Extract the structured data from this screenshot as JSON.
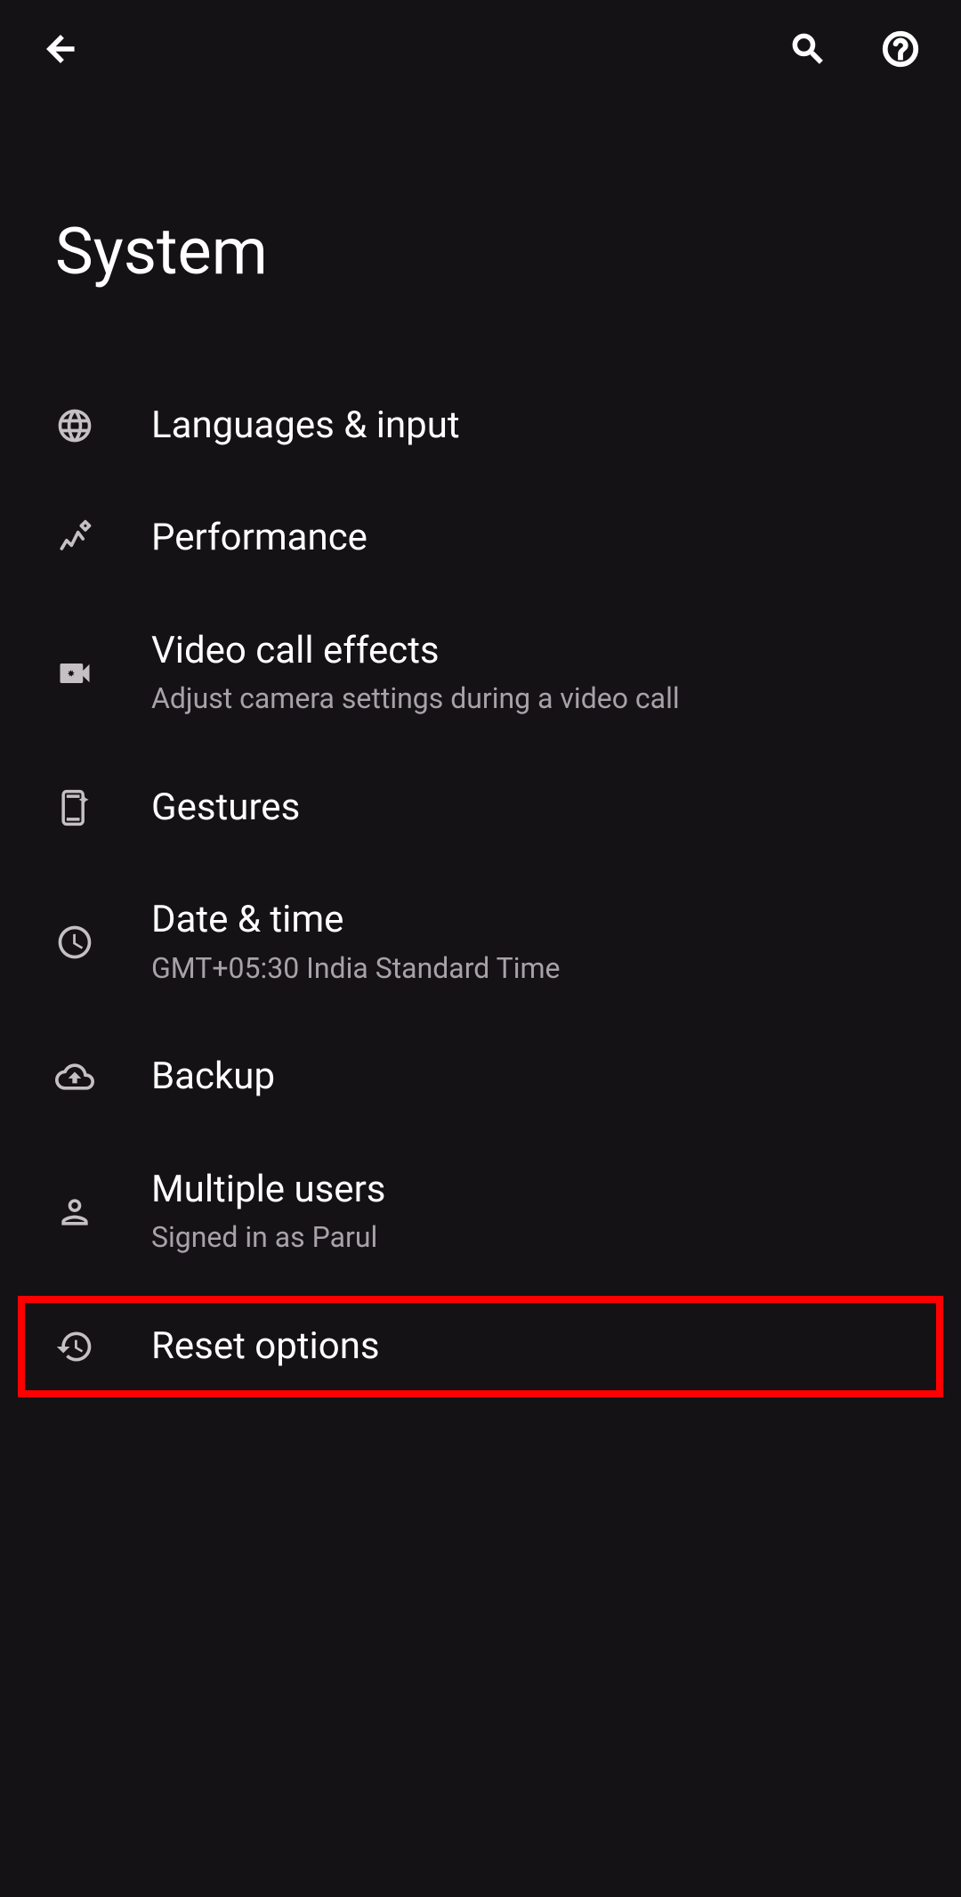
{
  "header": {
    "title": "System"
  },
  "items": [
    {
      "title": "Languages & input",
      "subtitle": null,
      "icon": "globe",
      "highlighted": false
    },
    {
      "title": "Performance",
      "subtitle": null,
      "icon": "performance",
      "highlighted": false
    },
    {
      "title": "Video call effects",
      "subtitle": "Adjust camera settings during a video call",
      "icon": "video-cam",
      "highlighted": false
    },
    {
      "title": "Gestures",
      "subtitle": null,
      "icon": "phone-sparkle",
      "highlighted": false
    },
    {
      "title": "Date & time",
      "subtitle": "GMT+05:30 India Standard Time",
      "icon": "clock",
      "highlighted": false
    },
    {
      "title": "Backup",
      "subtitle": null,
      "icon": "cloud-upload",
      "highlighted": false
    },
    {
      "title": "Multiple users",
      "subtitle": "Signed in as Parul",
      "icon": "person",
      "highlighted": false
    },
    {
      "title": "Reset options",
      "subtitle": null,
      "icon": "reset",
      "highlighted": true
    }
  ]
}
